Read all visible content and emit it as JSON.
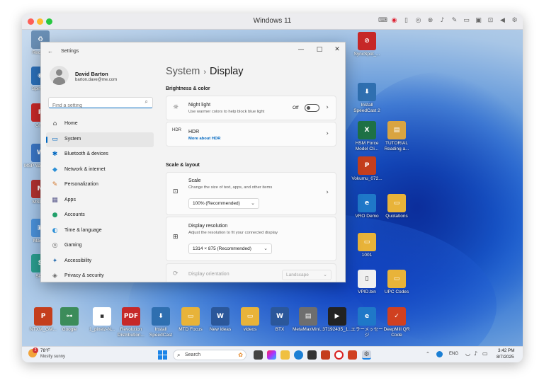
{
  "host": {
    "title": "Windows 11"
  },
  "desktop": {
    "icons": [
      {
        "label": "Recycle",
        "color": "#6a8fb5",
        "glyph": "♻"
      },
      {
        "label": "SpinBox",
        "color": "#2b6fb8",
        "glyph": "◉"
      },
      {
        "label": "GRP",
        "color": "#c62828",
        "glyph": "P"
      },
      {
        "label": "MSP ValueView",
        "color": "#3a75c4",
        "glyph": "W"
      },
      {
        "label": "MSDAV",
        "color": "#b03030",
        "glyph": "M"
      },
      {
        "label": "Mac Hi",
        "color": "#4a90d9",
        "glyph": "▣"
      },
      {
        "label": "SPS",
        "color": "#2a9d8f",
        "glyph": "S"
      },
      {
        "label": "SyncSpot_...",
        "color": "#c62828",
        "glyph": "⊘"
      },
      {
        "label": "Install SpeedCast 2",
        "color": "#2f6fb0",
        "glyph": "⬇"
      },
      {
        "label": "HSM Force Model Cli...",
        "color": "#1e7145",
        "glyph": "X"
      },
      {
        "label": "TUTORIAL Reading a...",
        "color": "#d9a441",
        "glyph": "▤"
      },
      {
        "label": "Vokumu_072...",
        "color": "#c43e1c",
        "glyph": "P"
      },
      {
        "label": "VRO Demo",
        "color": "#1f78c8",
        "glyph": "e"
      },
      {
        "label": "Quotations",
        "color": "#e8b339",
        "glyph": "▭"
      },
      {
        "label": "1001",
        "color": "#e8b339",
        "glyph": "▭"
      },
      {
        "label": "VPID.bin",
        "color": "#f0f0f0",
        "glyph": "▯"
      },
      {
        "label": "UPC Codes",
        "color": "#e8b339",
        "glyph": "▭"
      },
      {
        "label": "NTXM_GM...",
        "color": "#c43e1c",
        "glyph": "P"
      },
      {
        "label": "Google",
        "color": "#3c8c5a",
        "glyph": "⊶"
      },
      {
        "label": "1_pixelz-N...",
        "color": "#ffffff",
        "glyph": "▪"
      },
      {
        "label": "Revolution Distribution...",
        "color": "#c62828",
        "glyph": "PDF"
      },
      {
        "label": "Install SpeedCast",
        "color": "#2f6fb0",
        "glyph": "⬇"
      },
      {
        "label": "MTD Focus",
        "color": "#e8b339",
        "glyph": "▭"
      },
      {
        "label": "New ideas",
        "color": "#2b579a",
        "glyph": "W"
      },
      {
        "label": "videos",
        "color": "#e8b339",
        "glyph": "▭"
      },
      {
        "label": "BTX",
        "color": "#2b579a",
        "glyph": "W"
      },
      {
        "label": "MetaMaxMini...",
        "color": "#6e6e6e",
        "glyph": "▤"
      },
      {
        "label": "37192435_1...",
        "color": "#222222",
        "glyph": "▶"
      },
      {
        "label": "エラーメッセージ",
        "color": "#1f78c8",
        "glyph": "e"
      },
      {
        "label": "DeepMill QR Code",
        "color": "#d04020",
        "glyph": "✓"
      }
    ]
  },
  "taskbar": {
    "weather_temp": "78°F",
    "weather_desc": "Mostly sunny",
    "weather_badge": "2",
    "search_placeholder": "Search",
    "lang": "ENG",
    "time": "3:42 PM",
    "date": "8/7/2025"
  },
  "settings": {
    "window_title": "Settings",
    "user": {
      "name": "David Barton",
      "email": "barton.dave@me.com"
    },
    "search_placeholder": "Find a setting",
    "nav": [
      {
        "label": "Home",
        "icon": "⌂",
        "color": "#555555",
        "active": false
      },
      {
        "label": "System",
        "icon": "▭",
        "color": "#0067c0",
        "active": true
      },
      {
        "label": "Bluetooth & devices",
        "icon": "✱",
        "color": "#0067c0",
        "active": false
      },
      {
        "label": "Network & internet",
        "icon": "◆",
        "color": "#2b8fd6",
        "active": false
      },
      {
        "label": "Personalization",
        "icon": "✎",
        "color": "#d2762b",
        "active": false
      },
      {
        "label": "Apps",
        "icon": "▦",
        "color": "#5a5a8c",
        "active": false
      },
      {
        "label": "Accounts",
        "icon": "●",
        "color": "#22a06b",
        "active": false
      },
      {
        "label": "Time & language",
        "icon": "◐",
        "color": "#2b8fd6",
        "active": false
      },
      {
        "label": "Gaming",
        "icon": "◎",
        "color": "#666666",
        "active": false
      },
      {
        "label": "Accessibility",
        "icon": "✦",
        "color": "#2b6fb0",
        "active": false
      },
      {
        "label": "Privacy & security",
        "icon": "◈",
        "color": "#666666",
        "active": false
      }
    ],
    "breadcrumb": {
      "parent": "System",
      "current": "Display"
    },
    "section_brightness": "Brightness & color",
    "night_light": {
      "title": "Night light",
      "subtitle": "Use warmer colors to help block blue light",
      "state": "Off"
    },
    "hdr": {
      "title": "HDR",
      "link": "More about HDR"
    },
    "section_scale": "Scale & layout",
    "scale": {
      "title": "Scale",
      "subtitle": "Change the size of text, apps, and other items",
      "value": "100% (Recommended)"
    },
    "resolution": {
      "title": "Display resolution",
      "subtitle": "Adjust the resolution to fit your connected display",
      "value": "1314 × 875 (Recommended)"
    },
    "orientation": {
      "title": "Display orientation",
      "value": "Landscape"
    }
  }
}
